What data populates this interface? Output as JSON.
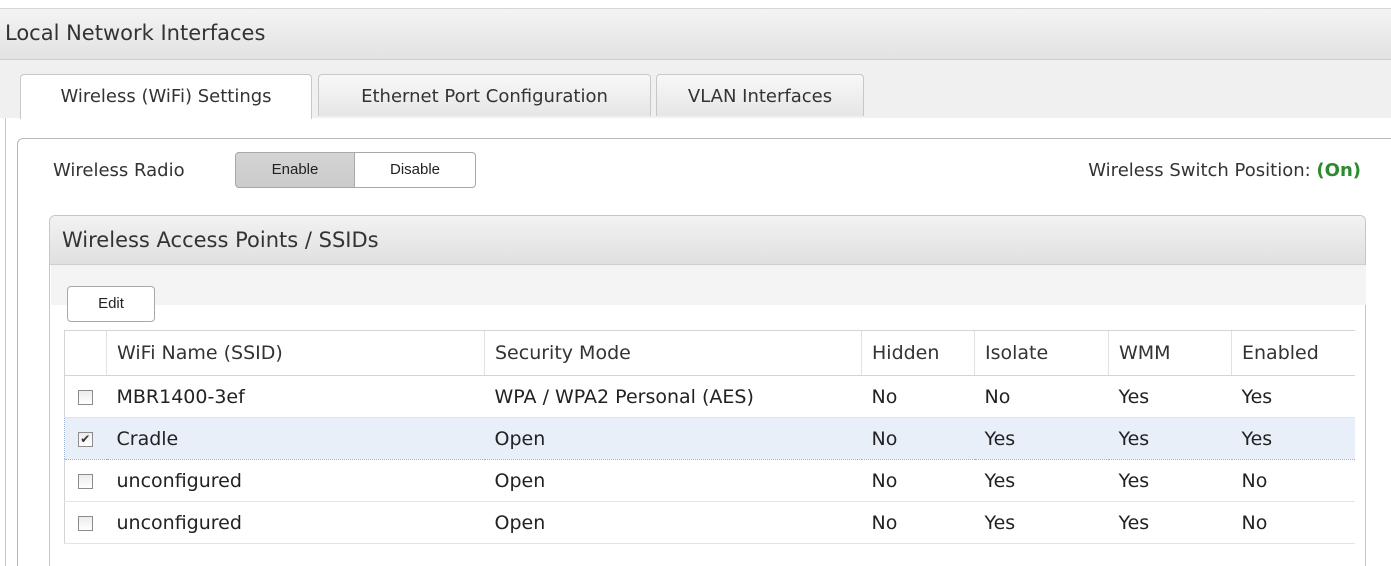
{
  "header": {
    "title": "Local Network Interfaces"
  },
  "tabs": [
    {
      "label": "Wireless (WiFi) Settings",
      "active": true
    },
    {
      "label": "Ethernet Port Configuration",
      "active": false
    },
    {
      "label": "VLAN Interfaces",
      "active": false
    }
  ],
  "radio": {
    "label": "Wireless Radio",
    "enable_label": "Enable",
    "disable_label": "Disable",
    "selected": "Enable"
  },
  "switch": {
    "label": "Wireless Switch Position: ",
    "value": "(On)",
    "value_color": "#2e8a2e"
  },
  "access_points": {
    "title": "Wireless Access Points / SSIDs",
    "edit_label": "Edit",
    "columns": [
      "",
      "WiFi Name (SSID)",
      "Security Mode",
      "Hidden",
      "Isolate",
      "WMM",
      "Enabled"
    ],
    "rows": [
      {
        "checked": false,
        "ssid": "MBR1400-3ef",
        "security": "WPA / WPA2 Personal (AES)",
        "hidden": "No",
        "isolate": "No",
        "wmm": "Yes",
        "enabled": "Yes"
      },
      {
        "checked": true,
        "ssid": "Cradle",
        "security": "Open",
        "hidden": "No",
        "isolate": "Yes",
        "wmm": "Yes",
        "enabled": "Yes"
      },
      {
        "checked": false,
        "ssid": "unconfigured",
        "security": "Open",
        "hidden": "No",
        "isolate": "Yes",
        "wmm": "Yes",
        "enabled": "No"
      },
      {
        "checked": false,
        "ssid": "unconfigured",
        "security": "Open",
        "hidden": "No",
        "isolate": "Yes",
        "wmm": "Yes",
        "enabled": "No"
      }
    ]
  }
}
